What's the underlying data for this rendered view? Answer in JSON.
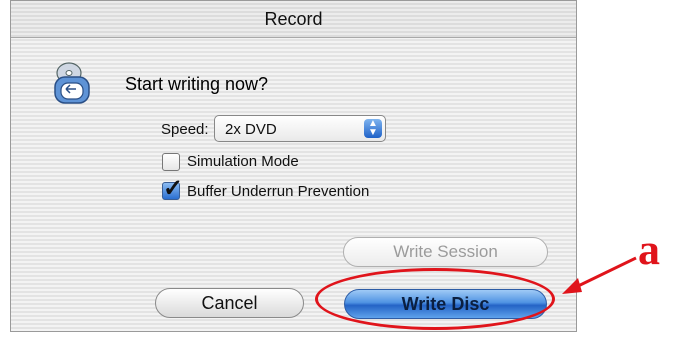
{
  "window": {
    "title": "Record"
  },
  "dialog": {
    "icon": "burn-disc-icon",
    "question": "Start writing now?",
    "speed": {
      "label": "Speed:",
      "value": "2x DVD"
    },
    "options": [
      {
        "label": "Simulation Mode",
        "checked": false
      },
      {
        "label": "Buffer Underrun Prevention",
        "checked": true
      }
    ],
    "buttons": {
      "write_session": "Write Session",
      "cancel": "Cancel",
      "write_disc": "Write Disc"
    }
  },
  "annotation": {
    "letter": "a",
    "color": "#e0141b"
  }
}
